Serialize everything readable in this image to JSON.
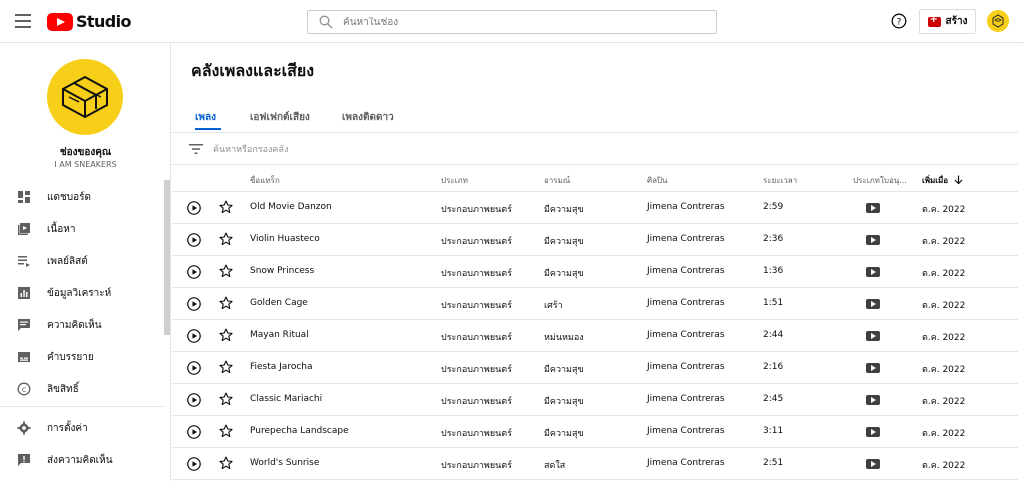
{
  "app": {
    "logo_text": "Studio"
  },
  "header": {
    "search_placeholder": "ค้นหาในช่อง",
    "create_label": "สร้าง"
  },
  "channel": {
    "title": "ช่องของคุณ",
    "name": "I AM SNEAKERS"
  },
  "sidebar": {
    "items": [
      {
        "label": "แดชบอร์ด",
        "icon": "dashboard-icon"
      },
      {
        "label": "เนื้อหา",
        "icon": "content-icon"
      },
      {
        "label": "เพลย์ลิสต์",
        "icon": "playlist-icon"
      },
      {
        "label": "ข้อมูลวิเคราะห์",
        "icon": "analytics-icon"
      },
      {
        "label": "ความคิดเห็น",
        "icon": "comments-icon"
      },
      {
        "label": "คำบรรยาย",
        "icon": "subtitles-icon"
      },
      {
        "label": "ลิขสิทธิ์",
        "icon": "copyright-icon"
      }
    ],
    "bottom_items": [
      {
        "label": "การตั้งค่า",
        "icon": "settings-icon"
      },
      {
        "label": "ส่งความคิดเห็น",
        "icon": "feedback-icon"
      }
    ]
  },
  "main": {
    "title": "คลังเพลงและเสียง",
    "tabs": [
      {
        "label": "เพลง",
        "active": true
      },
      {
        "label": "เอฟเฟกต์เสียง",
        "active": false
      },
      {
        "label": "เพลงติดดาว",
        "active": false
      }
    ],
    "filter_placeholder": "ค้นหาหรือกรองคลัง",
    "columns": [
      "ชื่อแทร็ก",
      "ประเภท",
      "อารมณ์",
      "ศิลปิน",
      "ระยะเวลา",
      "ประเภทใบอนุ...",
      "เพิ่มเมื่อ"
    ],
    "rows": [
      {
        "title": "Old Movie Danzon",
        "genre": "ประกอบภาพยนตร์",
        "mood": "มีความสุข",
        "artist": "Jimena Contreras",
        "duration": "2:59",
        "added": "ต.ค. 2022"
      },
      {
        "title": "Violin Huasteco",
        "genre": "ประกอบภาพยนตร์",
        "mood": "มีความสุข",
        "artist": "Jimena Contreras",
        "duration": "2:36",
        "added": "ต.ค. 2022"
      },
      {
        "title": "Snow Princess",
        "genre": "ประกอบภาพยนตร์",
        "mood": "มีความสุข",
        "artist": "Jimena Contreras",
        "duration": "1:36",
        "added": "ต.ค. 2022"
      },
      {
        "title": "Golden Cage",
        "genre": "ประกอบภาพยนตร์",
        "mood": "เศร้า",
        "artist": "Jimena Contreras",
        "duration": "1:51",
        "added": "ต.ค. 2022"
      },
      {
        "title": "Mayan Ritual",
        "genre": "ประกอบภาพยนตร์",
        "mood": "หม่นหมอง",
        "artist": "Jimena Contreras",
        "duration": "2:44",
        "added": "ต.ค. 2022"
      },
      {
        "title": "Fiesta Jarocha",
        "genre": "ประกอบภาพยนตร์",
        "mood": "มีความสุข",
        "artist": "Jimena Contreras",
        "duration": "2:16",
        "added": "ต.ค. 2022"
      },
      {
        "title": "Classic Mariachi",
        "genre": "ประกอบภาพยนตร์",
        "mood": "มีความสุข",
        "artist": "Jimena Contreras",
        "duration": "2:45",
        "added": "ต.ค. 2022"
      },
      {
        "title": "Purepecha Landscape",
        "genre": "ประกอบภาพยนตร์",
        "mood": "มีความสุข",
        "artist": "Jimena Contreras",
        "duration": "3:11",
        "added": "ต.ค. 2022"
      },
      {
        "title": "World's Sunrise",
        "genre": "ประกอบภาพยนตร์",
        "mood": "สดใส",
        "artist": "Jimena Contreras",
        "duration": "2:51",
        "added": "ต.ค. 2022"
      }
    ]
  },
  "colors": {
    "accent": "#065fd4",
    "brand_red": "#ff0000",
    "avatar_yellow": "#f7cf18"
  }
}
